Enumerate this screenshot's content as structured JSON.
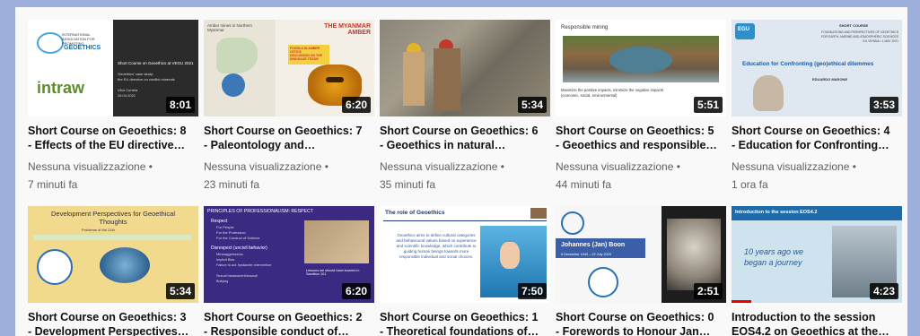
{
  "videos": [
    {
      "title": "Short Course on Geoethics: 8\n- Effects of the EU directive…",
      "views": "Nessuna visualizzazione •",
      "time": "7 minuti fa",
      "duration": "8:01"
    },
    {
      "title": "Short Course on Geoethics: 7\n- Paleontology and…",
      "views": "Nessuna visualizzazione •",
      "time": "23 minuti fa",
      "duration": "6:20"
    },
    {
      "title": "Short Course on Geoethics: 6\n- Geoethics in natural…",
      "views": "Nessuna visualizzazione •",
      "time": "35 minuti fa",
      "duration": "5:34"
    },
    {
      "title": "Short Course on Geoethics: 5\n- Geoethics and responsible…",
      "views": "Nessuna visualizzazione •",
      "time": "44 minuti fa",
      "duration": "5:51"
    },
    {
      "title": "Short Course on Geoethics: 4\n- Education for Confronting…",
      "views": "Nessuna visualizzazione •",
      "time": "1 ora fa",
      "duration": "3:53"
    },
    {
      "title": "Short Course on Geoethics: 3\n- Development Perspectives…",
      "duration": "5:34"
    },
    {
      "title": "Short Course on Geoethics: 2\n- Responsible conduct of…",
      "duration": "6:20"
    },
    {
      "title": "Short Course on Geoethics: 1\n- Theoretical foundations of…",
      "duration": "7:50"
    },
    {
      "title": "Short Course on Geoethics: 0\n- Forewords to Honour Jan…",
      "duration": "2:51"
    },
    {
      "title": "Introduction to the session\nEOS4.2 on Geoethics at the…",
      "duration": "4:23"
    }
  ],
  "thumbs": {
    "t1": {
      "line1": "Short Course on Geoethics at VEGU 2021",
      "line2": "Geoethics' case study:",
      "line3": "the EU directive on conflict minerals",
      "line4": "Vitor Correia",
      "line5": "26.04.2021",
      "logo": "intraw",
      "logo_top": "INTERNATIONAL ASSOCIATION FOR PROMOTING",
      "logo_bottom": "GEOETHICS"
    },
    "t2": {
      "heading": "THE MYANMAR AMBER",
      "left_label": "Amber mines in Northern Myanmar",
      "note1": "FOSSILS IN AMBER CETICS",
      "note2": "DISCUSSION ON THE DINOSAUR TRADE"
    },
    "t4": {
      "heading": "Responsible mining",
      "caption1": "Maximize the positive impacts, minimize the negative impacts",
      "caption2": "(economic, social, environmental)"
    },
    "t5": {
      "egu": "EGU",
      "short": "SHORT COURSE",
      "sub1": "FOUNDATIONS AND PERSPECTIVES OF GEOETHICS",
      "sub2": "FOR EARTH, MARINE AND ATMOSPHERIC SCIENCES",
      "sub3": "EU VIENNA • 1 MAY 2021",
      "edu": "Education for Confronting (geo)ethical dilemmes",
      "name": "EDUARDO MARONE"
    },
    "t6": {
      "title": "Development Perspectives for Geoethical Thoughts",
      "sub": "Problems of the 21th"
    },
    "t7": {
      "heading": "PRINCIPLES OF PROFESSIONALISM: RESPECT",
      "respect": "Respect",
      "b1": "For People",
      "b2": "For the Profession",
      "b3": "For the Conduct of Science",
      "disrespect": "Disrespect (uncivil behavior)",
      "d1": "Microaggressions",
      "d2": "Implicit Bias",
      "d3": "Failure to act: bystander intervention",
      "d4": "Sexual harassment/assault",
      "d5": "Bullying",
      "caption": "Lessons we should have learned in Sandbox 101"
    },
    "t8": {
      "heading": "The role of Geoethics",
      "body": "Geoethics aims to define cultural categories and behavioural values based on experience and scientific knowledge, which contribute to guiding human beings towards more responsible individual and social choices."
    },
    "t9": {
      "name": "Johannes (Jan) Boon",
      "dates": "6 December 1940 – 22 July 2020"
    },
    "t10": {
      "heading": "Introduction to the session EOS4.2",
      "quote1": "10 years ago we",
      "quote2": "began a journey"
    }
  }
}
